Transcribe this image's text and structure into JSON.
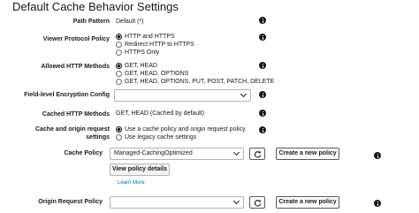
{
  "page_title": "Default Cache Behavior Settings",
  "rows": {
    "path_pattern": {
      "label": "Path Pattern",
      "value": "Default (*)"
    },
    "viewer_protocol": {
      "label": "Viewer Protocol Policy",
      "options": [
        "HTTP and HTTPS",
        "Redirect HTTP to HTTPS",
        "HTTPS Only"
      ],
      "selected_index": 0
    },
    "allowed_methods": {
      "label": "Allowed HTTP Methods",
      "options": [
        "GET, HEAD",
        "GET, HEAD, OPTIONS",
        "GET, HEAD, OPTIONS, PUT, POST, PATCH, DELETE"
      ],
      "selected_index": 0
    },
    "field_level_encryption": {
      "label": "Field-level Encryption Config",
      "value": ""
    },
    "cached_methods": {
      "label": "Cached HTTP Methods",
      "value": "GET, HEAD (Cached by default)"
    },
    "cache_origin_request": {
      "label_line1": "Cache and origin request",
      "label_line2": "settings",
      "options": [
        "Use a cache policy and origin request policy",
        "Use legacy cache settings"
      ],
      "selected_index": 0
    },
    "cache_policy": {
      "label": "Cache Policy",
      "value": "Managed-CachingOptimized",
      "create_button": "Create a new policy",
      "view_button": "View policy details",
      "learn_more": "Learn More"
    },
    "origin_request_policy": {
      "label": "Origin Request Policy",
      "value": "",
      "create_button": "Create a new policy"
    }
  },
  "icons": {
    "info": "info-icon",
    "refresh": "refresh-icon",
    "dropdown": "chevron-down-icon"
  }
}
